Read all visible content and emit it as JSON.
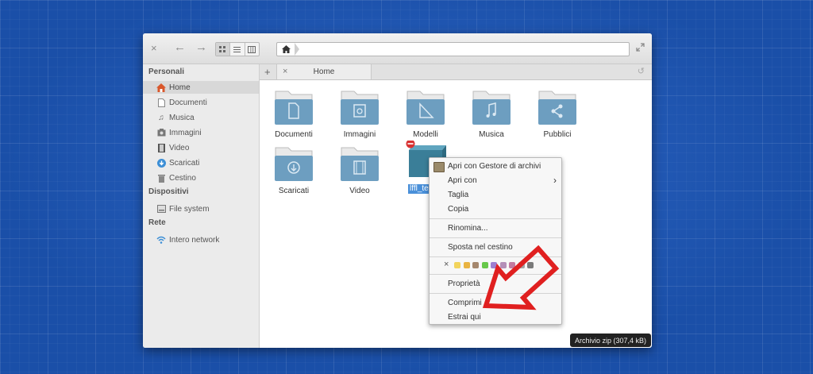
{
  "toolbar": {
    "close_icon": "×",
    "back_icon": "←",
    "forward_icon": "→",
    "view_modes": [
      "grid-view-icon",
      "list-view-icon",
      "column-view-icon"
    ],
    "active_view": "grid",
    "breadcrumb_home_icon": "home-icon",
    "maximize_icon": "expand-icon"
  },
  "sidebar": {
    "sections": [
      {
        "title": "Personali",
        "items": [
          {
            "label": "Home",
            "icon": "home-icon",
            "active": true
          },
          {
            "label": "Documenti",
            "icon": "document-icon"
          },
          {
            "label": "Musica",
            "icon": "music-icon"
          },
          {
            "label": "Immagini",
            "icon": "image-icon"
          },
          {
            "label": "Video",
            "icon": "video-icon"
          },
          {
            "label": "Scaricati",
            "icon": "download-icon"
          },
          {
            "label": "Cestino",
            "icon": "trash-icon"
          }
        ]
      },
      {
        "title": "Dispositivi",
        "items": [
          {
            "label": "File system",
            "icon": "drive-icon"
          }
        ]
      },
      {
        "title": "Rete",
        "items": [
          {
            "label": "Intero network",
            "icon": "wifi-icon"
          }
        ]
      }
    ]
  },
  "tabs": {
    "add_label": "+",
    "close_label": "×",
    "current": "Home",
    "restore_icon": "↺"
  },
  "files": [
    {
      "label": "Documenti",
      "icon": "document-folder-icon"
    },
    {
      "label": "Immagini",
      "icon": "images-folder-icon"
    },
    {
      "label": "Modelli",
      "icon": "templates-folder-icon"
    },
    {
      "label": "Musica",
      "icon": "music-folder-icon"
    },
    {
      "label": "Pubblici",
      "icon": "share-folder-icon"
    },
    {
      "label": "Scaricati",
      "icon": "download-folder-icon"
    },
    {
      "label": "Video",
      "icon": "video-folder-icon"
    },
    {
      "label": "lffl_tes",
      "icon": "zip-archive-icon",
      "selected": true
    }
  ],
  "context_menu": {
    "open_with_app": "Apri con Gestore di archivi",
    "open_with": "Apri con",
    "cut": "Taglia",
    "copy": "Copia",
    "rename": "Rinomina...",
    "trash": "Sposta nel cestino",
    "color_clear": "×",
    "colors": [
      "#f2d45c",
      "#e9b342",
      "#a5876d",
      "#67c84a",
      "#9d7fd0",
      "#b48fb8",
      "#c37aa0",
      "#a4a4a4",
      "#7a7a7a"
    ],
    "properties": "Proprietà",
    "compress": "Comprimi",
    "extract": "Estrai qui"
  },
  "status": "Archivio zip (307,4 kB)",
  "colors": {
    "folder": "#6d9ec0",
    "selection": "#4a90d9",
    "annotation_arrow": "#e02020"
  }
}
